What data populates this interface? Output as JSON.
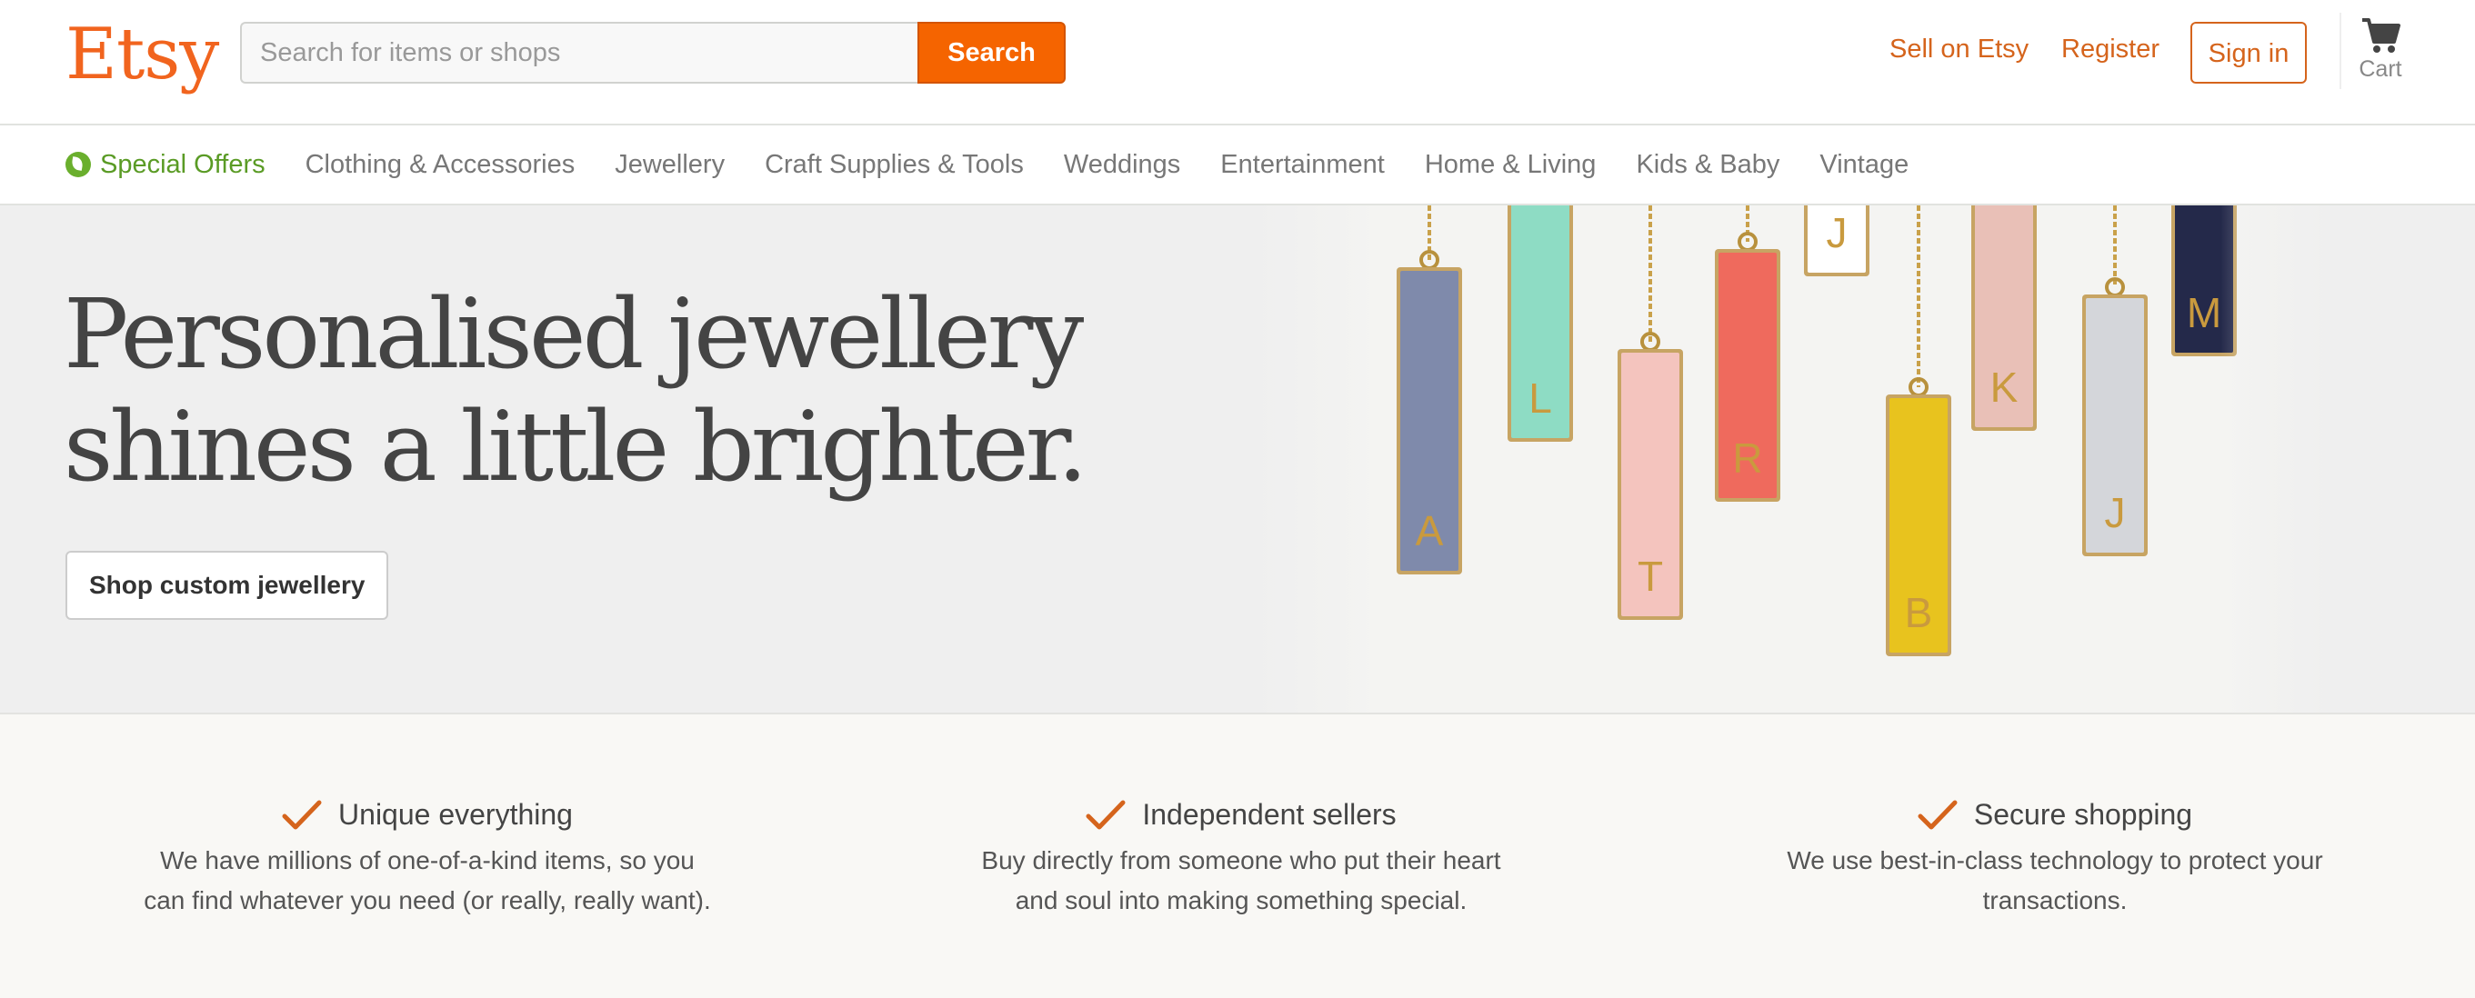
{
  "brand": {
    "name": "Etsy",
    "accent": "#f1641e",
    "button_orange": "#f56400",
    "link_color": "#d5641c"
  },
  "search": {
    "placeholder": "Search for items or shops",
    "value": "",
    "button_label": "Search"
  },
  "header_links": {
    "sell": "Sell on Etsy",
    "register": "Register",
    "sign_in": "Sign in",
    "cart": "Cart"
  },
  "categories": {
    "special_offers": "Special Offers",
    "items": [
      "Clothing & Accessories",
      "Jewellery",
      "Craft Supplies & Tools",
      "Weddings",
      "Entertainment",
      "Home & Living",
      "Kids & Baby",
      "Vintage"
    ]
  },
  "hero": {
    "title": "Personalised jewellery shines a little brighter.",
    "button_label": "Shop custom jewellery",
    "pendants": [
      {
        "letter": "A",
        "color": "#7f8aab"
      },
      {
        "letter": "L",
        "color": "#8edcc4"
      },
      {
        "letter": "T",
        "color": "#f4c4be"
      },
      {
        "letter": "R",
        "color": "#ef6a5d"
      },
      {
        "letter": "J",
        "color": "#ffffff"
      },
      {
        "letter": "B",
        "color": "#e8c31e"
      },
      {
        "letter": "K",
        "color": "#e9c0b7"
      },
      {
        "letter": "J",
        "color": "#d4d6da"
      },
      {
        "letter": "M",
        "color": "#24294a"
      }
    ]
  },
  "value_props": [
    {
      "title": "Unique everything",
      "line1": "We have millions of one-of-a-kind items, so you",
      "line2": "can find whatever you need (or really, really want)."
    },
    {
      "title": "Independent sellers",
      "line1": "Buy directly from someone who put their heart",
      "line2": "and soul into making something special."
    },
    {
      "title": "Secure shopping",
      "line1": "We use best-in-class technology to protect your",
      "line2": "transactions."
    }
  ],
  "icons": {
    "check": "check-icon",
    "cart": "cart-icon",
    "special": "leaf-icon"
  }
}
